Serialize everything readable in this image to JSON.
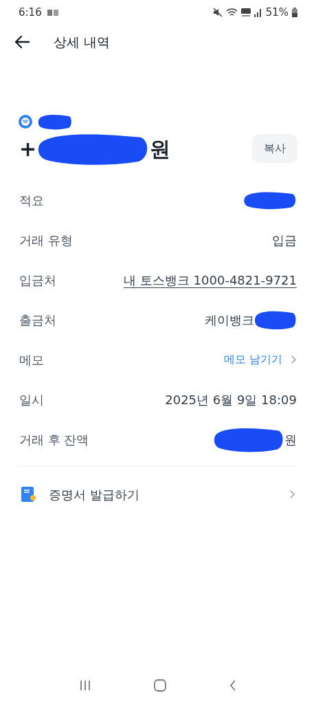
{
  "status_bar": {
    "time": "6:16",
    "battery": "51%"
  },
  "header": {
    "title": "상세 내역"
  },
  "amount": {
    "sign": "+",
    "unit": "원",
    "copy_button": "복사"
  },
  "rows": [
    {
      "label": "적요",
      "scribble_before": true
    },
    {
      "label": "거래 유형",
      "kind": "text",
      "value": "입금"
    },
    {
      "label": "입금처",
      "kind": "link",
      "value": "내 토스뱅크 1000-4821-9721"
    },
    {
      "label": "출금처",
      "kind": "text",
      "value": "케이뱅크",
      "scribble_after": true
    },
    {
      "label": "메모",
      "kind": "action",
      "value": "메모 남기기"
    },
    {
      "label": "일시",
      "kind": "text",
      "value": "2025년 6월 9일 18:09"
    },
    {
      "label": "거래 후 잔액",
      "kind": "text",
      "value": "원",
      "scribble_before": true
    }
  ],
  "certificate": {
    "label": "증명서 발급하기"
  }
}
